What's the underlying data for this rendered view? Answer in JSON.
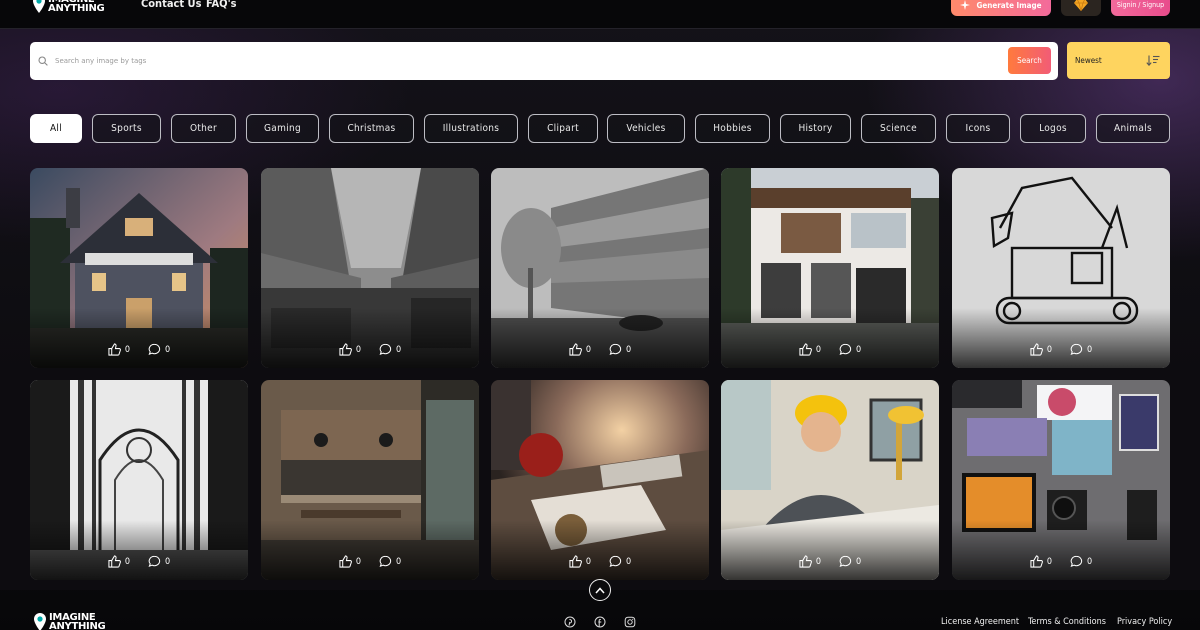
{
  "brand": {
    "name_line1": "IMAGINE",
    "name_line2": "ANYTHING"
  },
  "nav": {
    "contact": "Contact Us",
    "faqs": "FAQ's"
  },
  "header_buttons": {
    "generate": "Generate Image",
    "signin": "Signin / Signup",
    "gem_icon": "gem-icon"
  },
  "search": {
    "placeholder": "Search any image by tags",
    "button": "Search"
  },
  "sort": {
    "label": "Newest",
    "icon": "sort-descending-icon"
  },
  "tags": [
    "All",
    "Sports",
    "Other",
    "Gaming",
    "Christmas",
    "Illustrations",
    "Clipart",
    "Vehicles",
    "Hobbies",
    "History",
    "Science",
    "Icons",
    "Logos",
    "Animals"
  ],
  "active_tag": "All",
  "cards": [
    {
      "subject": "house",
      "likes": "0",
      "comments": "0"
    },
    {
      "subject": "street-market",
      "likes": "0",
      "comments": "0"
    },
    {
      "subject": "building-street",
      "likes": "0",
      "comments": "0"
    },
    {
      "subject": "modern-house",
      "likes": "0",
      "comments": "0"
    },
    {
      "subject": "excavator",
      "likes": "0",
      "comments": "0"
    },
    {
      "subject": "cathedral",
      "likes": "0",
      "comments": "0"
    },
    {
      "subject": "kitchen",
      "likes": "0",
      "comments": "0"
    },
    {
      "subject": "desk-sunset",
      "likes": "0",
      "comments": "0"
    },
    {
      "subject": "engineer",
      "likes": "0",
      "comments": "0"
    },
    {
      "subject": "electronics",
      "likes": "0",
      "comments": "0"
    }
  ],
  "footer": {
    "links": [
      "License Agreement",
      "Terms & Conditions",
      "Privacy Policy"
    ],
    "social": [
      "pinterest-icon",
      "facebook-icon",
      "instagram-icon"
    ]
  },
  "colors": {
    "accent_orange": "#ff7a3d",
    "accent_pink": "#f25c76",
    "sort_yellow": "#fed45f"
  }
}
